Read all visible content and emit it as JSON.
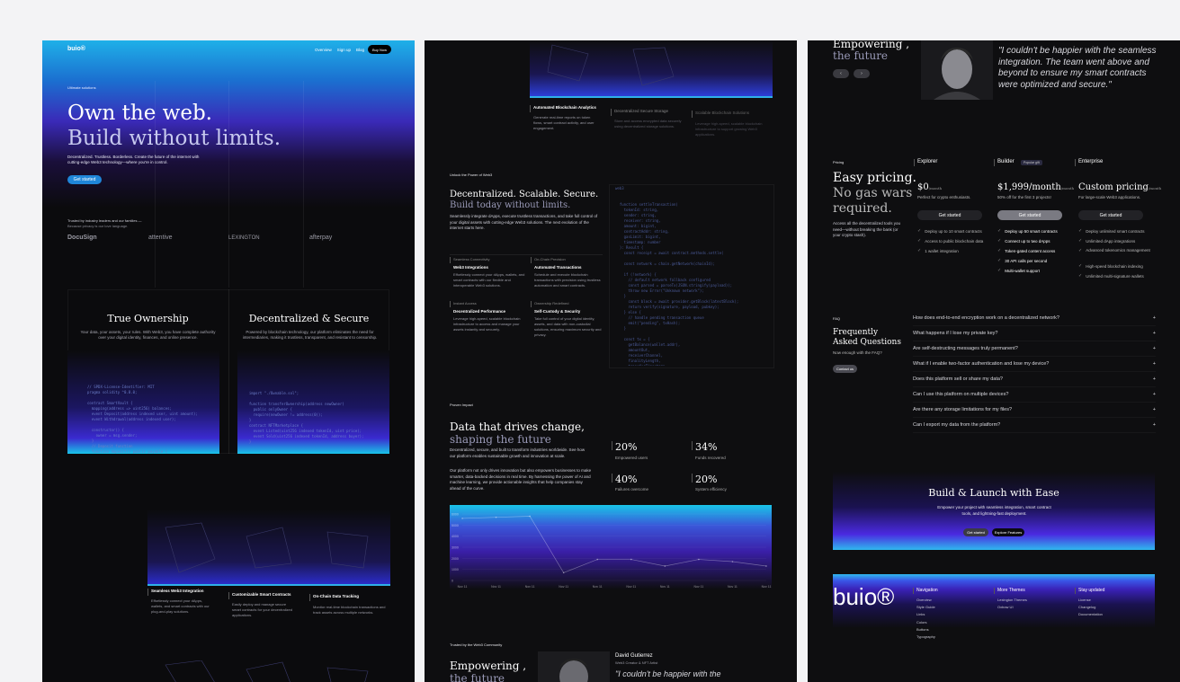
{
  "p1": {
    "logo": "buio®",
    "nav": [
      "Overview",
      "Sign up",
      "Blog"
    ],
    "cta": "Buy Now",
    "eyebrow": "Ultimate solutions",
    "hero_line1": "Own the web.",
    "hero_line2": "Build without limits.",
    "hero_sub": "Decentralized. Trustless. Borderless. Create the future of the internet with cutting-edge Web3 technology—where you're in control.",
    "hero_button": "Get started",
    "trusted_line1": "Trusted by industry leaders and our families —",
    "trusted_line2": "Because privacy is our love language.",
    "logos": [
      "DocuSign",
      "attentive",
      "LEXINGTON",
      "afterpay"
    ],
    "feature1_title": "True Ownership",
    "feature1_text": "Your data, your assets, your rules. With Web3, you have complete authority over your digital identity, finances, and online presence.",
    "feature2_title": "Decentralized & Secure",
    "feature2_text": "Powered by blockchain technology, our platform eliminates the need for intermediaries, making it trustless, transparent, and resistant to censorship.",
    "cards": [
      {
        "title": "Seamless Web3 Integration",
        "text": "Effortlessly connect your dApps, wallets, and smart contracts with our plug-and-play solutions."
      },
      {
        "title": "Customizable Smart Contracts",
        "text": "Easily deploy and manage secure smart contracts for your decentralized applications."
      },
      {
        "title": "On-Chain Data Tracking",
        "text": "Monitor real-time blockchain transactions and track assets across multiple networks."
      }
    ]
  },
  "p2": {
    "cards_top": [
      {
        "title": "Automated Blockchain Analytics",
        "text": "Generate real-time reports on token flows, smart contract activity, and user engagement."
      },
      {
        "title": "Decentralized Secure Storage",
        "text": "Store and access encrypted data securely using decentralized storage solutions."
      },
      {
        "title": "Scalable Blockchain Solutions",
        "text": "Leverage high-speed, scalable blockchain infrastructure to support growing Web3 applications."
      }
    ],
    "eyebrow": "Unlock the Power of Web3",
    "heading1": "Decentralized. Scalable. Secure.",
    "heading2": "Build today without limits.",
    "intro": "Seamlessly integrate dApps, execute trustless transactions, and take full control of your digital assets with cutting-edge Web3 solutions. The next evolution of the internet starts here.",
    "features": [
      {
        "eyebrow": "Seamless Connectivity",
        "title": "Web3 Integrations",
        "text": "Effortlessly connect your dApps, wallets, and smart contracts with our flexible and interoperable Web3 solutions."
      },
      {
        "eyebrow": "On-Chain Precision",
        "title": "Automated Transactions",
        "text": "Schedule and execute blockchain transactions with precision using trustless automation and smart contracts."
      },
      {
        "eyebrow": "Instant Access",
        "title": "Decentralized Performance",
        "text": "Leverage high-speed, scalable blockchain infrastructure to access and manage your assets instantly and securely."
      },
      {
        "eyebrow": "Ownership Redefined",
        "title": "Self-Custody & Security",
        "text": "Take full control of your digital identity, assets, and data with non-custodial solutions, ensuring maximum security and privacy."
      }
    ],
    "impact_eyebrow": "Proven Impact",
    "impact_h1": "Data that drives change,",
    "impact_h2": "shaping the future",
    "impact_p1": "Decentralized, secure, and built to transform industries worldwide. See how our platform enables sustainable growth and innovation at scale.",
    "impact_p2": "Our platform not only drives innovation but also empowers businesses to make smarter, data-backed decisions in real time. By harnessing the power of AI and machine learning, we provide actionable insights that help companies stay ahead of the curve.",
    "stats": [
      {
        "value": "20%",
        "label": "Empowered users"
      },
      {
        "value": "34%",
        "label": "Funds recovered"
      },
      {
        "value": "40%",
        "label": "Failures overcome"
      },
      {
        "value": "20%",
        "label": "System efficiency"
      }
    ],
    "community_eyebrow": "Trusted by the Web3 Community",
    "community_h1": "Empowering ,",
    "community_h2": "the future",
    "testimonial_name": "David Gutierrez",
    "testimonial_role": "Web3 Creator & NFT Artist",
    "testimonial_quote": "\"I couldn't be happier with the"
  },
  "chart_data": {
    "type": "line",
    "x": [
      "Nov 11",
      "Nov 11",
      "Nov 11",
      "Nov 11",
      "Nov 11",
      "Nov 11",
      "Nov 11",
      "Nov 11",
      "Nov 11",
      "Nov 11"
    ],
    "y_ticks": [
      "0",
      "1000",
      "2000",
      "3000",
      "4000",
      "5000",
      "6000"
    ],
    "series": [
      {
        "values": [
          5600,
          5700,
          5800,
          700,
          1900,
          1900,
          1300,
          1900,
          1700,
          1300
        ]
      }
    ],
    "ylim": [
      0,
      6000
    ],
    "grid": true
  },
  "p3": {
    "empowering1": "Empowering ,",
    "empowering2": "the future",
    "quote": "\"I couldn't be happier with the seamless integration. The team went above and beyond to ensure my smart contracts were optimized and secure.\"",
    "pricing_eyebrow": "Pricing",
    "pricing_h1": "Easy pricing.",
    "pricing_h2": "No gas wars",
    "pricing_h3": "required.",
    "pricing_text": "Access all the decentralized tools you need—without breaking the bank (or your crypto stash).",
    "plans": [
      {
        "name": "Explorer",
        "price": "$0",
        "unit": "/month",
        "desc": "Perfect for crypto enthusiasts.",
        "button": "Get started",
        "badge": "",
        "features": [
          "Deploy up to 10 smart contracts",
          "Access to public blockchain data",
          "1 wallet integration"
        ]
      },
      {
        "name": "Builder",
        "price": "$1,999/month",
        "unit": "/month",
        "desc": "50% off for the first 3 projects!",
        "button": "Get started",
        "badge": "Popular gift",
        "features": [
          "Deploy up 50 smart contracts",
          "Connect up to two dApps",
          "Token-gated content access",
          "30 API calls per second",
          "Multi-wallet support"
        ]
      },
      {
        "name": "Enterprise",
        "price": "Custom pricing",
        "unit": "/month",
        "desc": "For large-scale Web3 applications.",
        "button": "Get started",
        "badge": "",
        "features": [
          "Deploy unlimited smart contracts",
          "Unlimited dApp integrations",
          "Advanced tokenomics management",
          "High-speed blockchain indexing",
          "Unlimited multi-signature wallets"
        ]
      }
    ],
    "faq_eyebrow": "FAQ",
    "faq_h1": "Frequently",
    "faq_h2": "Asked Questions",
    "faq_sub": "Now enough with the FAQ?",
    "faq_button": "Contact us",
    "faqs": [
      "How does end-to-end encryption work on a decentralized network?",
      "What happens if I lose my private key?",
      "Are self-destructing messages truly permanent?",
      "What if I enable two-factor authentication and lose my device?",
      "Does this platform sell or share my data?",
      "Can I use this platform on multiple devices?",
      "Are there any storage limitations for my files?",
      "Can I export my data from the platform?"
    ],
    "plus": "+",
    "launch_h": "Build & Launch with Ease",
    "launch_p": "Empower your project with seamless integration, smart contract tools, and lightning-fast deployment.",
    "launch_b1": "Get started",
    "launch_b2": "Explore Features",
    "footer_logo": "buio®",
    "footer_cols": [
      {
        "title": "Navigation",
        "items": [
          "Overview",
          "Style Guide",
          "Links",
          "Colors",
          "Buttons",
          "Typography"
        ]
      },
      {
        "title": "More Themes",
        "items": [
          "Lexington Themes",
          "Oxbow UI"
        ]
      },
      {
        "title": "Stay updated",
        "items": [
          "License",
          "Changelog",
          "Documentation"
        ]
      }
    ]
  },
  "colors": {
    "accent": "#1f7fd6",
    "cyan": "#19c4e8",
    "purple": "#5a2ad8",
    "bg": "#0b0b0d"
  }
}
